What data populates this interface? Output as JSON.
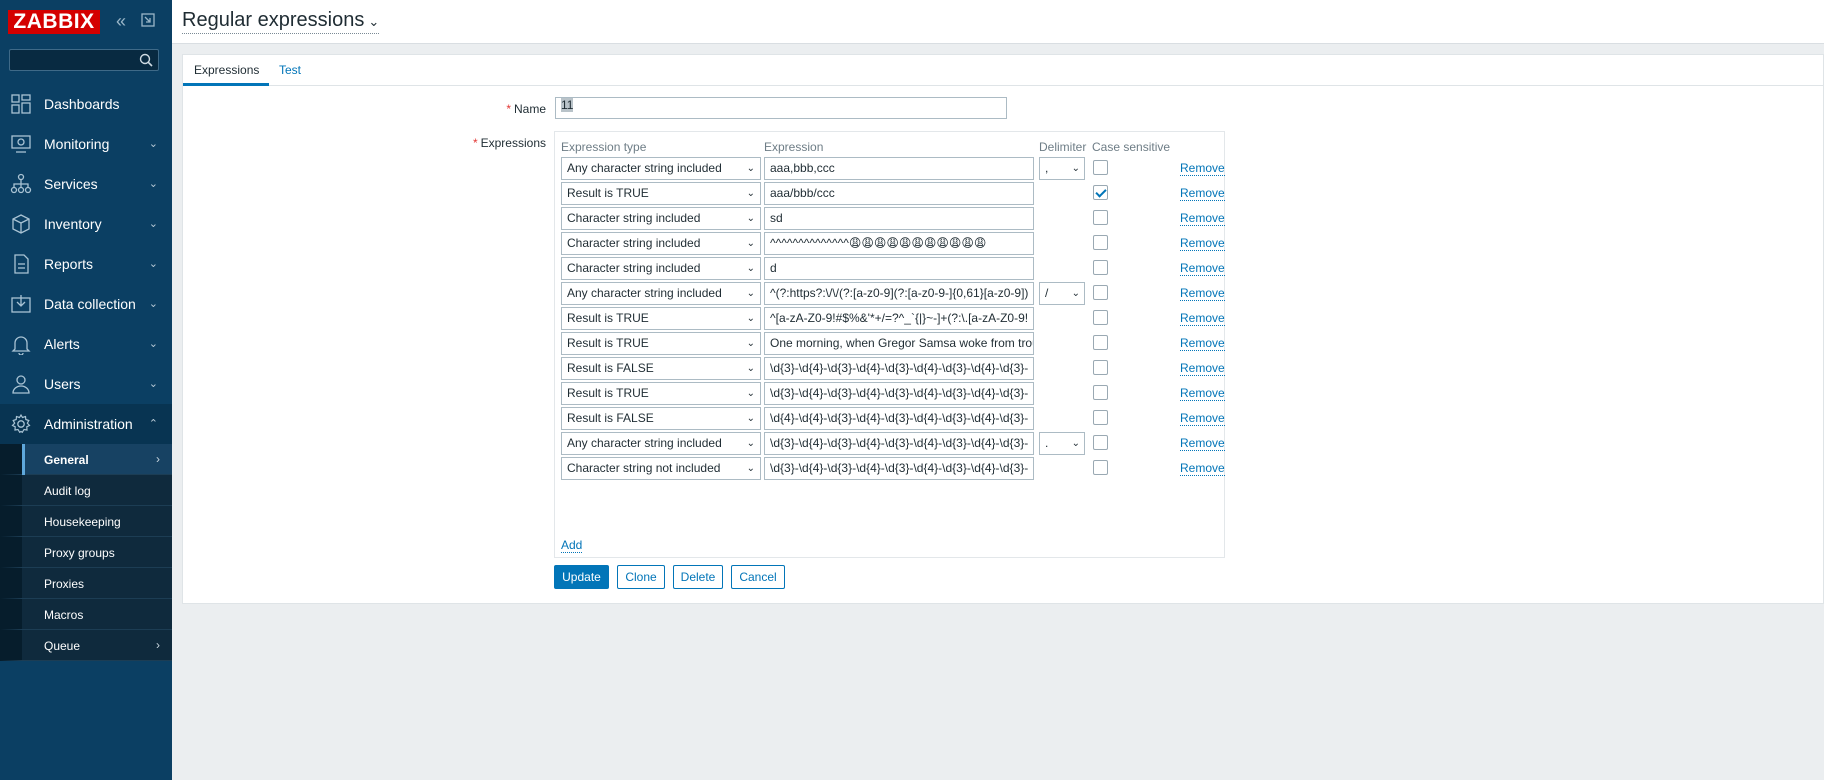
{
  "app": {
    "logo": "ZABBIX",
    "collapse_icon": "«",
    "expand_icon": "⇱"
  },
  "search": {
    "placeholder": "",
    "value": ""
  },
  "sidebar": {
    "items": [
      {
        "label": "Dashboards",
        "icon": "dashboards-icon",
        "chevron": ""
      },
      {
        "label": "Monitoring",
        "icon": "monitoring-icon",
        "chevron": "⌄"
      },
      {
        "label": "Services",
        "icon": "services-icon",
        "chevron": "⌄"
      },
      {
        "label": "Inventory",
        "icon": "inventory-icon",
        "chevron": "⌄"
      },
      {
        "label": "Reports",
        "icon": "reports-icon",
        "chevron": "⌄"
      },
      {
        "label": "Data collection",
        "icon": "data-collection-icon",
        "chevron": "⌄"
      },
      {
        "label": "Alerts",
        "icon": "alerts-icon",
        "chevron": "⌄"
      },
      {
        "label": "Users",
        "icon": "users-icon",
        "chevron": "⌄"
      },
      {
        "label": "Administration",
        "icon": "administration-icon",
        "chevron": "⌃"
      }
    ],
    "submenu": [
      {
        "label": "General",
        "chevron": "›"
      },
      {
        "label": "Audit log",
        "chevron": ""
      },
      {
        "label": "Housekeeping",
        "chevron": ""
      },
      {
        "label": "Proxy groups",
        "chevron": ""
      },
      {
        "label": "Proxies",
        "chevron": ""
      },
      {
        "label": "Macros",
        "chevron": ""
      },
      {
        "label": "Queue",
        "chevron": "›"
      }
    ]
  },
  "header": {
    "title": "Regular expressions",
    "title_caret": "⌄"
  },
  "tabs": {
    "expressions": "Expressions",
    "test": "Test"
  },
  "form": {
    "required_mark": "*",
    "name_label": "Name",
    "name_value": "11",
    "expressions_label": "Expressions"
  },
  "table": {
    "headers": {
      "type": "Expression type",
      "expression": "Expression",
      "delimiter": "Delimiter",
      "case": "Case sensitive"
    },
    "remove_label": "Remove",
    "add_label": "Add",
    "dropdown_glyph": "⌄",
    "rows": [
      {
        "type": "Any character string included",
        "expression": "aaa,bbb,ccc",
        "delimiter": ",",
        "case": false
      },
      {
        "type": "Result is TRUE",
        "expression": "aaa/bbb/ccc",
        "delimiter": null,
        "case": true
      },
      {
        "type": "Character string included",
        "expression": "sd",
        "delimiter": null,
        "case": false
      },
      {
        "type": "Character string included",
        "expression": "^^^^^^^^^^^^^^😩😩😩😩😩😩😩😩😩😩😩",
        "delimiter": null,
        "case": false
      },
      {
        "type": "Character string included",
        "expression": "d",
        "delimiter": null,
        "case": false
      },
      {
        "type": "Any character string included",
        "expression": "^(?:https?:\\/\\/(?:[a-z0-9](?:[a-z0-9-]{0,61}[a-z0-9])",
        "delimiter": "/",
        "case": false
      },
      {
        "type": "Result is TRUE",
        "expression": "^[a-zA-Z0-9!#$%&'*+/=?^_`{|}~-]+(?:\\.[a-zA-Z0-9!",
        "delimiter": null,
        "case": false
      },
      {
        "type": "Result is TRUE",
        "expression": "One morning, when Gregor Samsa woke from troubled dreams",
        "delimiter": null,
        "case": false
      },
      {
        "type": "Result is FALSE",
        "expression": "\\d{3}-\\d{4}-\\d{3}-\\d{4}-\\d{3}-\\d{4}-\\d{3}-\\d{4}-\\d{3}-",
        "delimiter": null,
        "case": false
      },
      {
        "type": "Result is TRUE",
        "expression": "\\d{3}-\\d{4}-\\d{3}-\\d{4}-\\d{3}-\\d{4}-\\d{3}-\\d{4}-\\d{3}-",
        "delimiter": null,
        "case": false
      },
      {
        "type": "Result is FALSE",
        "expression": "\\d{4}-\\d{4}-\\d{3}-\\d{4}-\\d{3}-\\d{4}-\\d{3}-\\d{4}-\\d{3}-",
        "delimiter": null,
        "case": false
      },
      {
        "type": "Any character string included",
        "expression": "\\d{3}-\\d{4}-\\d{3}-\\d{4}-\\d{3}-\\d{4}-\\d{3}-\\d{4}-\\d{3}-",
        "delimiter": ".",
        "case": false
      },
      {
        "type": "Character string not included",
        "expression": "\\d{3}-\\d{4}-\\d{3}-\\d{4}-\\d{3}-\\d{4}-\\d{3}-\\d{4}-\\d{3}-",
        "delimiter": null,
        "case": false
      }
    ]
  },
  "buttons": {
    "update": "Update",
    "clone": "Clone",
    "delete": "Delete",
    "cancel": "Cancel"
  }
}
